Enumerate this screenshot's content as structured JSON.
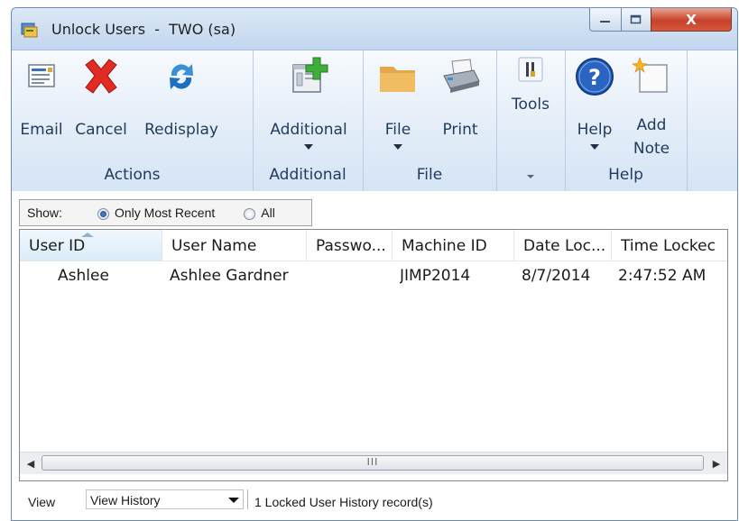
{
  "window": {
    "title": "Unlock Users  -  TWO (sa)",
    "controls": {
      "minimize": "—",
      "maximize": "☐",
      "close": "X"
    }
  },
  "ribbon": {
    "groups": [
      {
        "label": "Actions",
        "buttons": [
          {
            "label": "Email",
            "icon": "email-icon"
          },
          {
            "label": "Cancel",
            "icon": "cancel-icon"
          },
          {
            "label": "Redisplay",
            "icon": "redisplay-icon"
          }
        ]
      },
      {
        "label": "Additional",
        "buttons": [
          {
            "label": "Additional",
            "icon": "additional-icon"
          }
        ]
      },
      {
        "label": "File",
        "buttons": [
          {
            "label": "File",
            "icon": "folder-icon"
          },
          {
            "label": "Print",
            "icon": "printer-icon"
          }
        ]
      },
      {
        "label": "",
        "buttons": [
          {
            "label": "Tools",
            "icon": "tools-icon"
          }
        ]
      },
      {
        "label": "Help",
        "buttons": [
          {
            "label": "Help",
            "icon": "help-icon"
          },
          {
            "label": "Add\nNote",
            "label_line1": "Add",
            "label_line2": "Note",
            "icon": "note-icon"
          }
        ]
      }
    ]
  },
  "show_filter": {
    "label": "Show:",
    "options": [
      "Only Most Recent",
      "All"
    ],
    "selected": "Only Most Recent"
  },
  "table": {
    "columns": [
      "User ID",
      "User Name",
      "Passwo...",
      "Machine ID",
      "Date Loc...",
      "Time Lockec"
    ],
    "sorted_column": "User ID",
    "rows": [
      [
        "Ashlee",
        "Ashlee Gardner",
        "",
        "JIMP2014",
        "8/7/2014",
        "2:47:52 AM"
      ]
    ],
    "scroll_thumb_mark": "III"
  },
  "status_bar": {
    "view_label": "View",
    "view_selected": "View History",
    "record_count_text": "1 Locked User History record(s)"
  },
  "colors": {
    "frame": "#c9dcf0",
    "ribbon_text": "#1e3a5f",
    "close_button": "#c7412a",
    "sort_highlight": "#d9ecf9"
  }
}
